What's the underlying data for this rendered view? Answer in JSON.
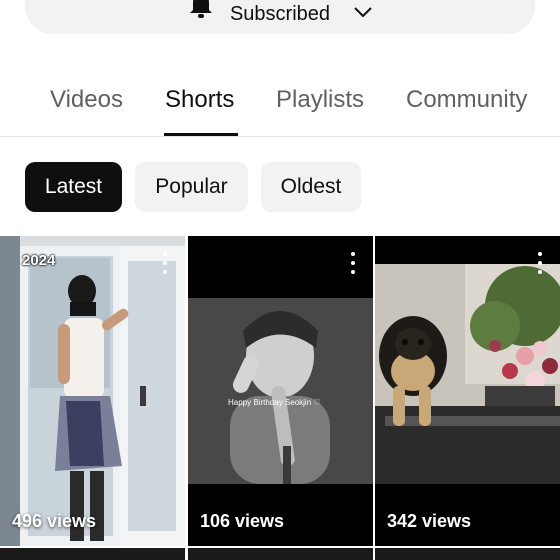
{
  "subscribe": {
    "label": "Subscribed"
  },
  "tabs": [
    {
      "label": "Videos",
      "active": false
    },
    {
      "label": "Shorts",
      "active": true
    },
    {
      "label": "Playlists",
      "active": false
    },
    {
      "label": "Community",
      "active": false
    }
  ],
  "filters": [
    {
      "label": "Latest",
      "active": true
    },
    {
      "label": "Popular",
      "active": false
    },
    {
      "label": "Oldest",
      "active": false
    }
  ],
  "shorts": [
    {
      "views": "496 views",
      "overlay_text": "2024"
    },
    {
      "views": "106 views",
      "caption": "Happy Birthday Seokjin ♡"
    },
    {
      "views": "342 views"
    }
  ],
  "icons": {
    "bell": "bell-icon",
    "chevron": "chevron-down-icon",
    "more": "more-vert-icon"
  },
  "colors": {
    "active_chip_bg": "#0f0f0f",
    "chip_bg": "#f2f2f2",
    "inactive_tab": "#606060"
  }
}
